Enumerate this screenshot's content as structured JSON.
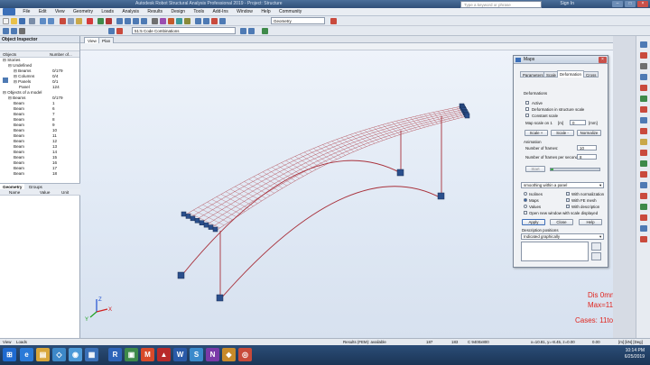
{
  "window": {
    "title_partial": "Autodesk Robot Structural Analysis Professional 2019 - Project: Structure",
    "search_placeholder": "Type a keyword or phrase",
    "sign_in": "Sign In"
  },
  "menu": [
    "File",
    "Edit",
    "View",
    "Geometry",
    "Loads",
    "Analysis",
    "Results",
    "Design",
    "Tools",
    "Add-Ins",
    "Window",
    "Help",
    "Community"
  ],
  "toolbar": {
    "combo_structure": "Geometry",
    "combo_case": "51:5 Code Combinations"
  },
  "object_inspector": {
    "title": "Object Inspector",
    "col_objects": "Objects",
    "col_number": "Number of...",
    "tree": [
      {
        "indent": 0,
        "label": "Stories",
        "value": ""
      },
      {
        "indent": 1,
        "label": "Undefined",
        "value": ""
      },
      {
        "indent": 2,
        "label": "Beams",
        "value": "0/179"
      },
      {
        "indent": 2,
        "label": "Columns",
        "value": "0/4"
      },
      {
        "indent": 2,
        "label": "Panels",
        "value": "0/1"
      },
      {
        "indent": 3,
        "label": "Panel",
        "value": "124"
      },
      {
        "indent": 0,
        "label": "Objects of a model",
        "value": ""
      },
      {
        "indent": 1,
        "label": "Beams",
        "value": "0/179"
      },
      {
        "indent": 2,
        "label": "Beam",
        "value": "1"
      },
      {
        "indent": 2,
        "label": "Beam",
        "value": "6"
      },
      {
        "indent": 2,
        "label": "Beam",
        "value": "7"
      },
      {
        "indent": 2,
        "label": "Beam",
        "value": "8"
      },
      {
        "indent": 2,
        "label": "Beam",
        "value": "9"
      },
      {
        "indent": 2,
        "label": "Beam",
        "value": "10"
      },
      {
        "indent": 2,
        "label": "Beam",
        "value": "11"
      },
      {
        "indent": 2,
        "label": "Beam",
        "value": "12"
      },
      {
        "indent": 2,
        "label": "Beam",
        "value": "13"
      },
      {
        "indent": 2,
        "label": "Beam",
        "value": "14"
      },
      {
        "indent": 2,
        "label": "Beam",
        "value": "15"
      },
      {
        "indent": 2,
        "label": "Beam",
        "value": "16"
      },
      {
        "indent": 2,
        "label": "Beam",
        "value": "17"
      },
      {
        "indent": 2,
        "label": "Beam",
        "value": "18"
      }
    ],
    "tabs": [
      "Geometry",
      "Groups"
    ],
    "grid_cols": [
      "Name",
      "Value",
      "Unit"
    ]
  },
  "view_tabs": [
    "View",
    "Plan"
  ],
  "maps_dialog": {
    "title": "Maps",
    "tabs": [
      "Parameters",
      "Scale",
      "Deformation",
      "Cross"
    ],
    "deformations_label": "Deformations",
    "active_label": "Active",
    "deformation_scale_label": "Deformation in structure scale",
    "constant_scale_label": "Constant scale",
    "map_scale_label": "Map scale on 1",
    "map_scale_unit": "[m]",
    "map_scale_value": "0",
    "map_scale_unit2": "[mm]",
    "scale_plus": "Scale +",
    "scale_minus": "Scale -",
    "normalize": "Normalize",
    "animation_label": "Animation",
    "frames_label": "Number of frames:",
    "frames_value": "10",
    "fps_label": "Number of frames per second:",
    "fps_value": "8",
    "start_label": "Start",
    "smoothing_label": "smoothing within a panel",
    "isolines_label": "Isolines",
    "maps_label": "Maps",
    "values_label": "Values",
    "with_normalization": "With normalization",
    "with_fe_mesh": "With FE mesh",
    "with_description": "With description",
    "open_new_window": "Open new window with scale displayed",
    "apply": "Apply",
    "close": "Close",
    "help": "Help",
    "desc_positions": "Description positions",
    "desc_value": "Indicated graphically"
  },
  "overlay": {
    "dis": "Dis   0mm",
    "max": "Max=11",
    "cases": "Cases: 11to19"
  },
  "axes": {
    "x": "X",
    "y": "Y",
    "z": "Z"
  },
  "status": {
    "tabs": [
      "View",
      "Loads"
    ],
    "results": "Results (FEM): available",
    "n1": "187",
    "n2": "183",
    "section": "C 9400x800",
    "coords": "x=10.81, y=-8.45, z=0.00",
    "zero": "0.00",
    "units": "[m] [kN] [Deg]"
  },
  "clock": {
    "time": "10:14 PM",
    "date": "6/25/2019"
  },
  "colors": {
    "accent": "#3b6fb8",
    "mesh": "#a8303a",
    "support": "#2a4f8c",
    "overlay_red": "#e0241d"
  }
}
